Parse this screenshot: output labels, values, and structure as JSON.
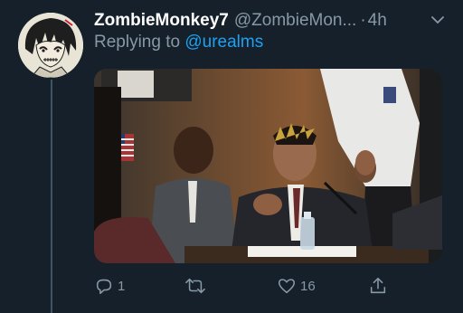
{
  "tweet": {
    "display_name": "ZombieMonkey7",
    "handle": "@ZombieMon...",
    "separator": "·",
    "time": "4h",
    "reply_prefix": "Replying to",
    "reply_user": "@urealms"
  },
  "actions": {
    "reply_count": "1",
    "retweet_count": "",
    "like_count": "16"
  },
  "icons": {
    "avatar": "anime-avatar",
    "menu": "chevron-down-icon",
    "reply": "reply-icon",
    "retweet": "retweet-icon",
    "like": "heart-icon",
    "share": "share-icon"
  },
  "colors": {
    "background": "#15202b",
    "secondary_text": "#8899a6",
    "link": "#1da1f2",
    "thread_line": "#3d5466"
  }
}
